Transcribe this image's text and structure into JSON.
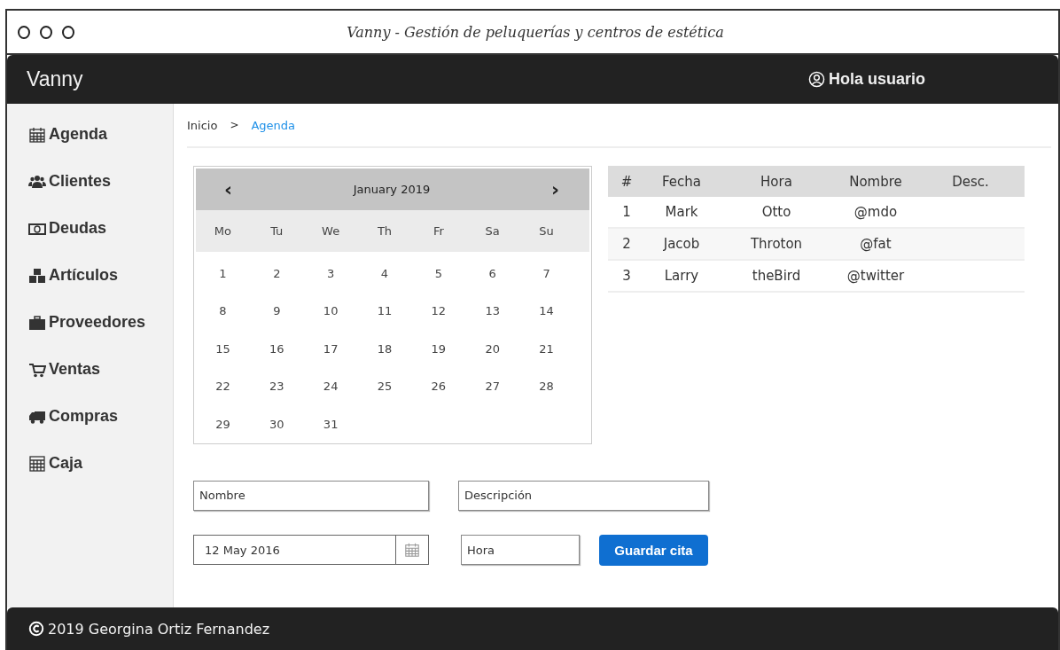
{
  "window": {
    "title": "Vanny - Gestión de peluquerías y centros de estética"
  },
  "header": {
    "brand": "Vanny",
    "user": "Hola usuario"
  },
  "sidebar": {
    "items": [
      {
        "label": "Agenda",
        "kind": "calendar"
      },
      {
        "label": "Clientes",
        "kind": "users"
      },
      {
        "label": "Deudas",
        "kind": "money"
      },
      {
        "label": "Artículos",
        "kind": "cubes"
      },
      {
        "label": "Proveedores",
        "kind": "briefcase"
      },
      {
        "label": "Ventas",
        "kind": "cart"
      },
      {
        "label": "Compras",
        "kind": "truck"
      },
      {
        "label": "Caja",
        "kind": "calculator"
      }
    ]
  },
  "breadcrumb": [
    {
      "label": "Inicio",
      "selected": false
    },
    {
      "label": "Agenda",
      "selected": true
    }
  ],
  "breadcrumb_separator": ">",
  "calendar": {
    "prev": "‹",
    "month": "January 2019",
    "next": "›",
    "weekdays": [
      "Mo",
      "Tu",
      "We",
      "Th",
      "Fr",
      "Sa",
      "Su"
    ],
    "weeks": [
      [
        "1",
        "2",
        "3",
        "4",
        "5",
        "6",
        "7"
      ],
      [
        "8",
        "9",
        "10",
        "11",
        "12",
        "13",
        "14"
      ],
      [
        "15",
        "16",
        "17",
        "18",
        "19",
        "20",
        "21"
      ],
      [
        "22",
        "23",
        "24",
        "25",
        "26",
        "27",
        "28"
      ],
      [
        "29",
        "30",
        "31"
      ]
    ]
  },
  "table": {
    "columns": [
      "#",
      "Fecha",
      "Hora",
      "Nombre",
      "Desc."
    ],
    "rows": [
      [
        "1",
        "Mark",
        "Otto",
        "@mdo"
      ],
      [
        "2",
        "Jacob",
        "Throton",
        "@fat"
      ],
      [
        "3",
        "Larry",
        "theBird",
        "@twitter"
      ]
    ]
  },
  "form": {
    "name": {
      "placeholder": "Nombre"
    },
    "description": {
      "placeholder": "Descripción"
    },
    "date": {
      "value": "12 May 2016"
    },
    "time": {
      "placeholder": "Hora"
    },
    "submit": "Guardar cita"
  },
  "footer": {
    "text": "2019 Georgina Ortiz Fernandez"
  }
}
